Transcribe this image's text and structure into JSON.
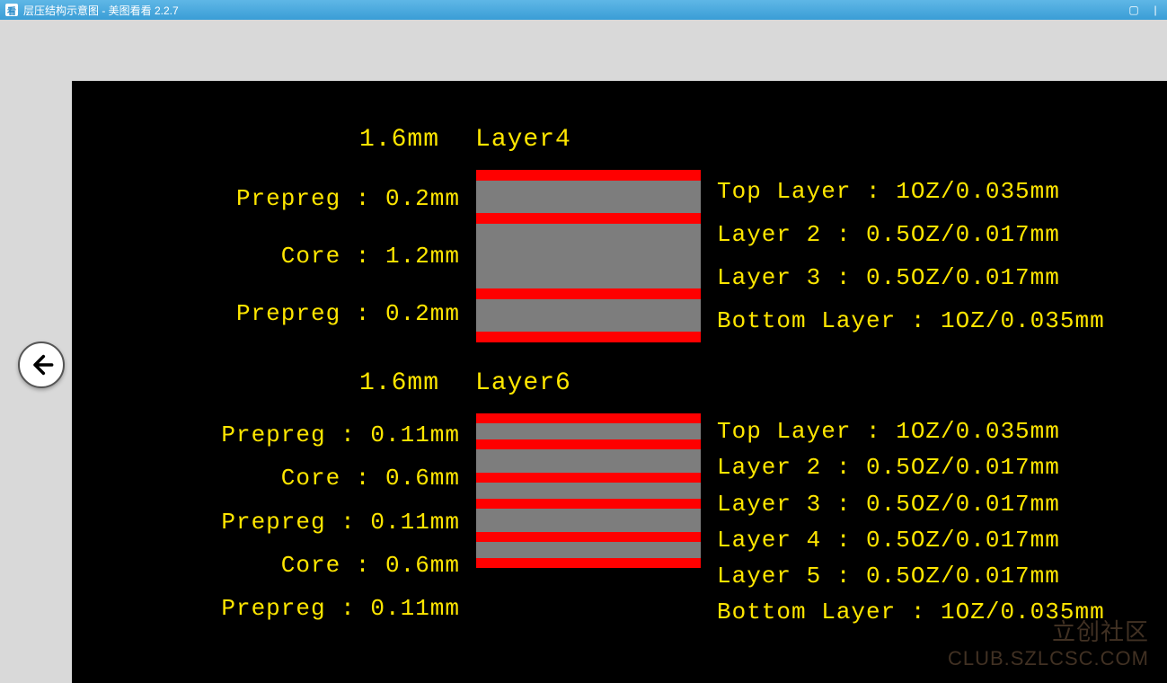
{
  "titlebar": {
    "title": "层压结构示意图 - 美图看看 2.2.7"
  },
  "stack4": {
    "total": "1.6mm",
    "name": "Layer4",
    "left": [
      "Prepreg : 0.2mm",
      "Core : 1.2mm",
      "Prepreg : 0.2mm"
    ],
    "right": [
      "Top Layer : 1OZ/0.035mm",
      "Layer 2 : 0.5OZ/0.017mm",
      "Layer 3 : 0.5OZ/0.017mm",
      "Bottom Layer : 1OZ/0.035mm"
    ]
  },
  "stack6": {
    "total": "1.6mm",
    "name": "Layer6",
    "left": [
      "Prepreg : 0.11mm",
      "Core : 0.6mm",
      "Prepreg : 0.11mm",
      "Core : 0.6mm",
      "Prepreg : 0.11mm"
    ],
    "right": [
      "Top Layer : 1OZ/0.035mm",
      "Layer 2 : 0.5OZ/0.017mm",
      "Layer 3 : 0.5OZ/0.017mm",
      "Layer 4 : 0.5OZ/0.017mm",
      "Layer 5 : 0.5OZ/0.017mm",
      "Bottom Layer : 1OZ/0.035mm"
    ]
  },
  "watermark": {
    "line1": "立创社区",
    "line2": "CLUB.SZLCSC.COM"
  }
}
